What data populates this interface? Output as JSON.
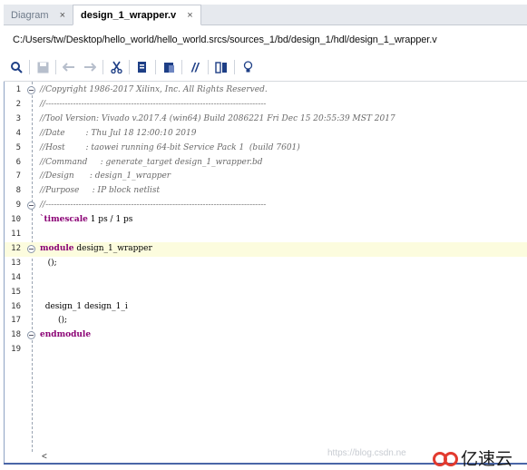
{
  "tabs": [
    {
      "label": "Diagram",
      "close": "×",
      "active": false
    },
    {
      "label": "design_1_wrapper.v",
      "close": "×",
      "active": true
    }
  ],
  "file_path": "C:/Users/tw/Desktop/hello_world/hello_world.srcs/sources_1/bd/design_1/hdl/design_1_wrapper.v",
  "toolbar": {
    "search": "search-icon",
    "save": "save-icon",
    "undo": "undo-icon",
    "redo": "redo-icon",
    "cut": "cut-icon",
    "copy": "copy-icon",
    "paste": "paste-icon",
    "comment": "//",
    "columns": "columns-icon",
    "bulb": "lightbulb-icon"
  },
  "code_lines": [
    {
      "n": "1",
      "text": "//Copyright 1986-2017 Xilinx, Inc. All Rights Reserved."
    },
    {
      "n": "2",
      "text": "//--------------------------------------------------------------------------------"
    },
    {
      "n": "3",
      "text": "//Tool Version: Vivado v.2017.4 (win64) Build 2086221 Fri Dec 15 20:55:39 MST 2017"
    },
    {
      "n": "4",
      "text": "//Date        : Thu Jul 18 12:00:10 2019"
    },
    {
      "n": "5",
      "text": "//Host        : taowei running 64-bit Service Pack 1  (build 7601)"
    },
    {
      "n": "6",
      "text": "//Command     : generate_target design_1_wrapper.bd"
    },
    {
      "n": "7",
      "text": "//Design      : design_1_wrapper"
    },
    {
      "n": "8",
      "text": "//Purpose     : IP block netlist"
    },
    {
      "n": "9",
      "text": "//--------------------------------------------------------------------------------"
    },
    {
      "n": "10",
      "text": "`timescale 1 ps / 1 ps"
    },
    {
      "n": "11",
      "text": ""
    },
    {
      "n": "12",
      "text": "module design_1_wrapper"
    },
    {
      "n": "13",
      "text": "   ();"
    },
    {
      "n": "14",
      "text": ""
    },
    {
      "n": "15",
      "text": ""
    },
    {
      "n": "16",
      "text": "  design_1 design_1_i"
    },
    {
      "n": "17",
      "text": "       ();"
    },
    {
      "n": "18",
      "text": "endmodule"
    },
    {
      "n": "19",
      "text": ""
    }
  ],
  "scroll_left": "<",
  "watermark": "https://blog.csdn.ne",
  "brand": "亿速云",
  "colors": {
    "accent": "#4a66a7",
    "keyword": "#8a0074",
    "current_line": "#fcfcde"
  }
}
